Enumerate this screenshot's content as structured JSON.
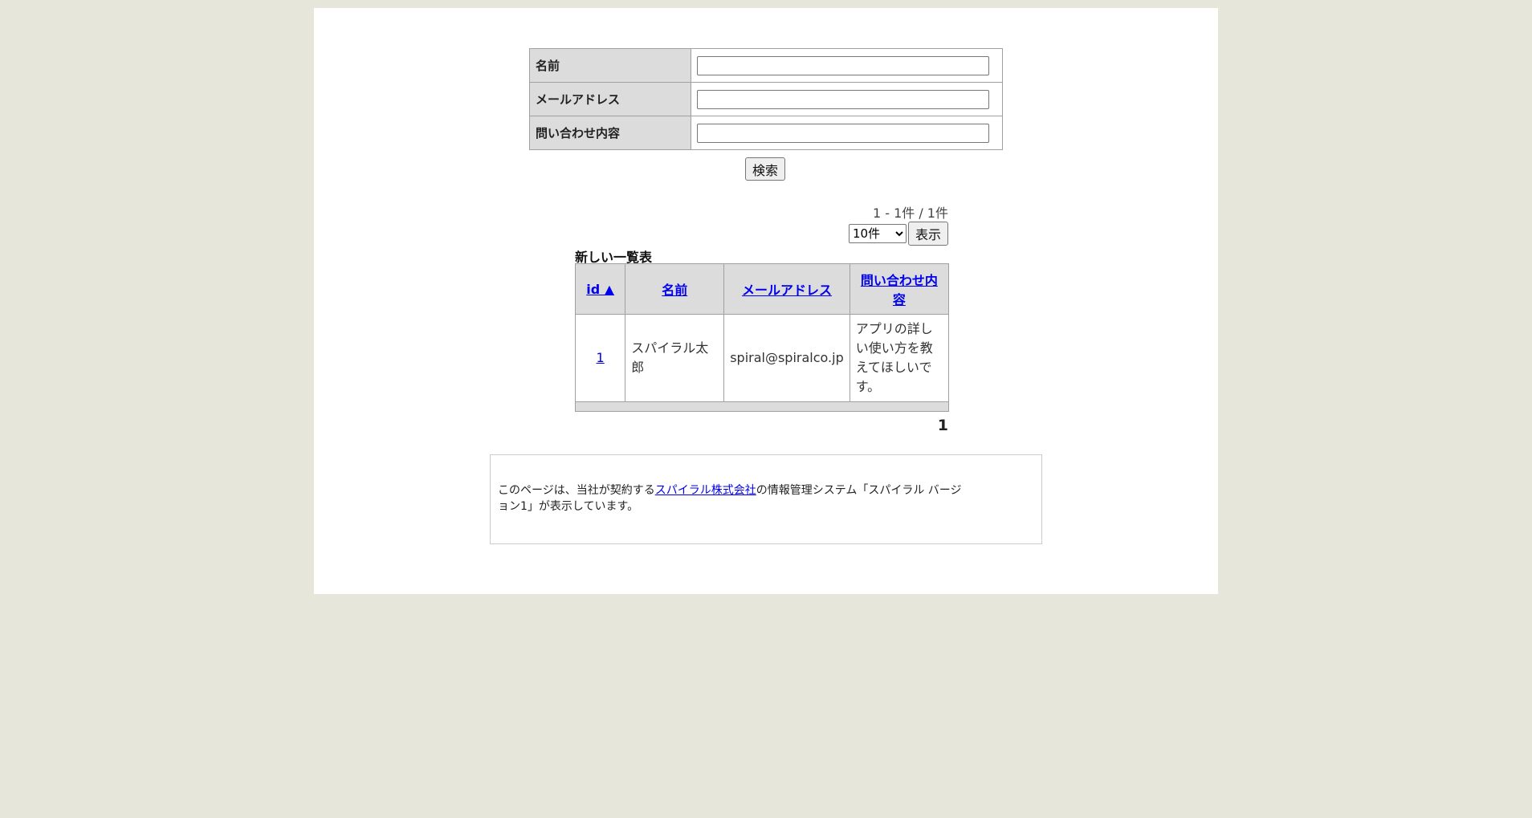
{
  "search_form": {
    "fields": [
      {
        "label": "名前",
        "value": ""
      },
      {
        "label": "メールアドレス",
        "value": ""
      },
      {
        "label": "問い合わせ内容",
        "value": ""
      }
    ],
    "submit_label": "検索"
  },
  "pager": {
    "count_text": "1 - 1件 / 1件",
    "per_page_selected": "10件",
    "show_label": "表示",
    "current_page": "1"
  },
  "list": {
    "title": "新しい一覧表",
    "headers": [
      "id ▲",
      "名前",
      "メールアドレス",
      "問い合わせ内容"
    ],
    "rows": [
      {
        "id": "1",
        "name": "スパイラル太郎",
        "email": "spiral@spiralco.jp",
        "body": "アプリの詳しい使い方を教えてほしいです。"
      }
    ]
  },
  "footer": {
    "text_before": "このページは、当社が契約する",
    "link_text": "スパイラル株式会社",
    "text_after": "の情報管理システム「スパイラル バージョン1」が表示しています。"
  }
}
